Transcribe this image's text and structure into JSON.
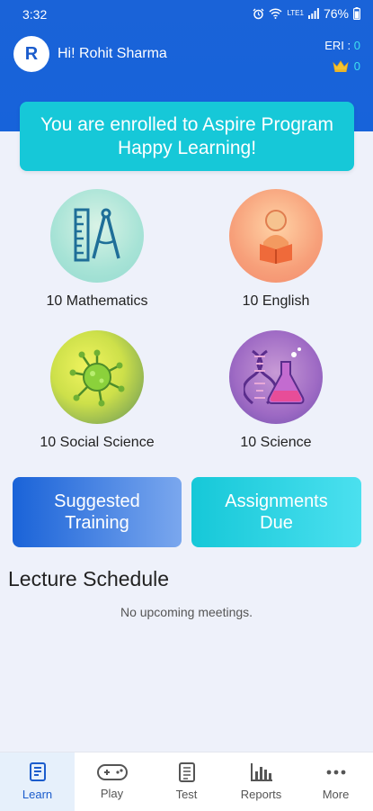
{
  "status": {
    "time": "3:32",
    "battery": "76%",
    "network": "LTE1"
  },
  "header": {
    "avatar_letter": "R",
    "greeting": "Hi! Rohit Sharma",
    "eri_label": "ERI :",
    "eri_value": "0",
    "crown_value": "0"
  },
  "banner": {
    "line1": "You are enrolled to Aspire Program",
    "line2": "Happy Learning!"
  },
  "subjects": [
    {
      "label": "10 Mathematics",
      "icon": "ruler-compass-icon"
    },
    {
      "label": "10 English",
      "icon": "reading-person-icon"
    },
    {
      "label": "10 Social Science",
      "icon": "virus-icon"
    },
    {
      "label": "10 Science",
      "icon": "dna-flask-icon"
    }
  ],
  "actions": {
    "suggested_line1": "Suggested",
    "suggested_line2": "Training",
    "assignments_line1": "Assignments",
    "assignments_line2": "Due"
  },
  "lecture": {
    "title": "Lecture Schedule",
    "empty_text": "No upcoming meetings."
  },
  "nav": [
    {
      "label": "Learn",
      "icon": "book-icon",
      "active": true
    },
    {
      "label": "Play",
      "icon": "gamepad-icon",
      "active": false
    },
    {
      "label": "Test",
      "icon": "test-sheet-icon",
      "active": false
    },
    {
      "label": "Reports",
      "icon": "bar-chart-icon",
      "active": false
    },
    {
      "label": "More",
      "icon": "more-dots-icon",
      "active": false
    }
  ],
  "colors": {
    "primary": "#1a63d8",
    "accent": "#16c8d8",
    "background": "#eef1fa"
  }
}
